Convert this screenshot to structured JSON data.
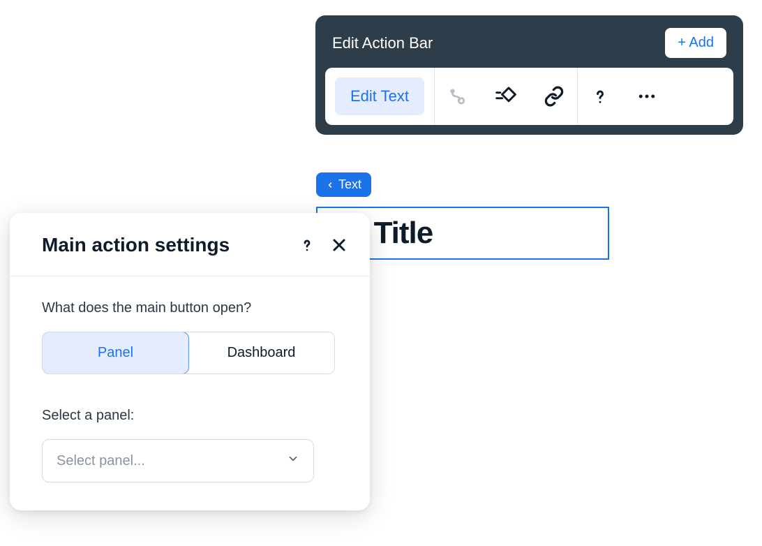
{
  "action_bar": {
    "title": "Edit Action Bar",
    "add_label": "+ Add",
    "edit_text_label": "Edit Text"
  },
  "text_pill": {
    "label": "Text"
  },
  "text_box": {
    "title": "ox Title"
  },
  "settings": {
    "title": "Main action settings",
    "question": "What does the main button open?",
    "options": {
      "panel": "Panel",
      "dashboard": "Dashboard"
    },
    "select_label": "Select a panel:",
    "select_placeholder": "Select panel..."
  }
}
